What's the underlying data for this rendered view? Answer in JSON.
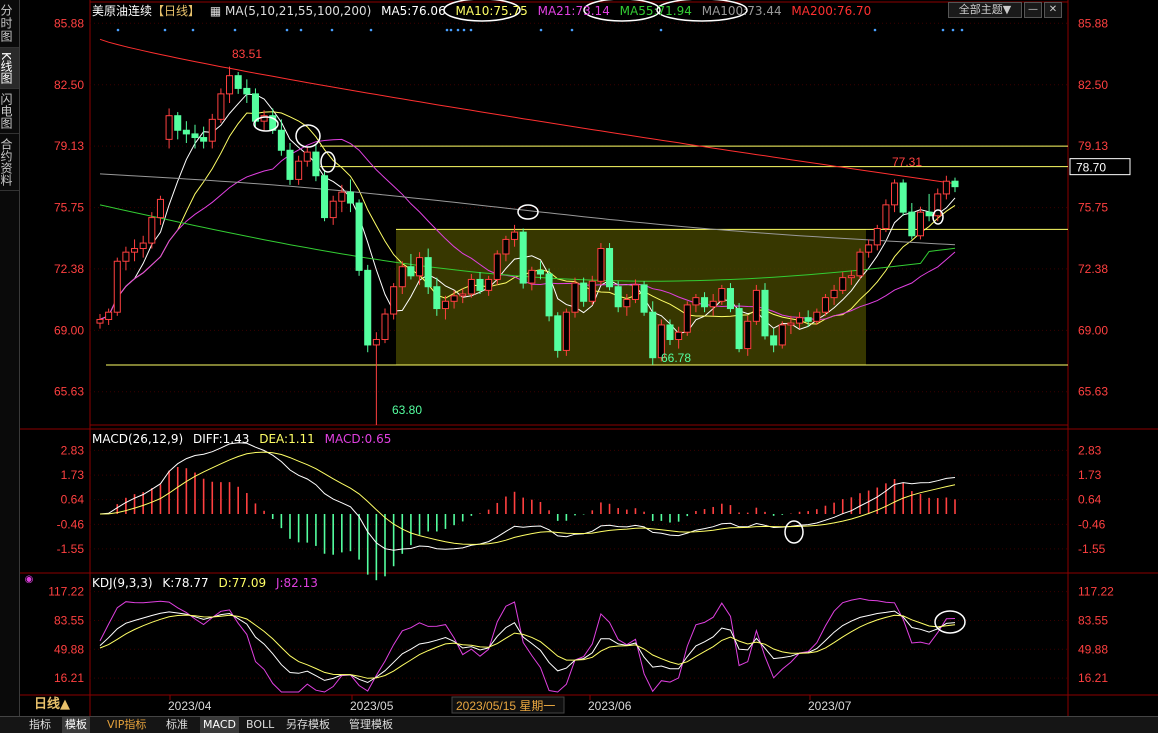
{
  "sidebar": {
    "tabs": [
      {
        "label": "分时图"
      },
      {
        "label": "K线图"
      },
      {
        "label": "闪电图"
      },
      {
        "label": "合约资料"
      }
    ]
  },
  "main_legend": {
    "symbol": "美原油连续",
    "period": "【日线】",
    "ma_set": "MA(5,10,21,55,100,200)",
    "ma5": "MA5:76.06",
    "ma10": "MA10:75.75",
    "ma21": "MA21:73.14",
    "ma55": "MA55:71.94",
    "ma100": "MA100:73.44",
    "ma200": "MA200:76.70"
  },
  "toolbar": {
    "theme_label": "全部主题▼",
    "min_label": "—",
    "close_label": "✕"
  },
  "macd_legend": {
    "name": "MACD(26,12,9)",
    "diff": "DIFF:1.43",
    "dea": "DEA:1.11",
    "macd": "MACD:0.65"
  },
  "kdj_legend": {
    "name": "KDJ(9,3,3)",
    "k": "K:78.77",
    "d": "D:77.09",
    "j": "J:82.13"
  },
  "price_axis": {
    "ticks": [
      "85.88",
      "82.50",
      "79.13",
      "75.75",
      "72.38",
      "69.00",
      "65.63"
    ],
    "last_price_label": "78.70"
  },
  "macd_axis": {
    "ticks": [
      "2.83",
      "1.73",
      "0.64",
      "-0.46",
      "-1.55"
    ]
  },
  "kdj_axis": {
    "ticks": [
      "117.22",
      "83.55",
      "49.88",
      "16.21"
    ]
  },
  "annotations": {
    "high": "83.51",
    "low": "63.80",
    "range_low": "66.78",
    "recent_high": "77.31"
  },
  "date_axis": {
    "labels": [
      "2023/04",
      "2023/05",
      "2023/06",
      "2023/07"
    ],
    "cursor_date": "2023/05/15 星期一"
  },
  "bottom_tabs": [
    {
      "label": "指标"
    },
    {
      "label": "模板"
    },
    {
      "label": "VIP指标"
    },
    {
      "label": "标准"
    },
    {
      "label": "MACD"
    },
    {
      "label": "BOLL"
    },
    {
      "label": "另存模板"
    },
    {
      "label": "管理模板"
    }
  ],
  "period_button": "日线▲",
  "colors": {
    "up": "#ff4040",
    "down": "#54ff9f",
    "ma5": "#ffffff",
    "ma10": "#ffff66",
    "ma21": "#e040e0",
    "ma55": "#33cc33",
    "ma100": "#999999",
    "ma200": "#ff3030",
    "grid": "#7a0000"
  },
  "chart_data": {
    "type": "candlestick",
    "title": "美原油连续",
    "price_ylim": [
      63.8,
      86.5
    ],
    "levels": [
      79.13,
      78.0,
      74.55,
      67.1
    ],
    "candles": [
      [
        69.4,
        69.9,
        69.1,
        69.6
      ],
      [
        69.6,
        70.2,
        69.3,
        70.0
      ],
      [
        70.0,
        73.0,
        69.8,
        72.8
      ],
      [
        72.8,
        73.6,
        72.3,
        73.3
      ],
      [
        73.3,
        74.0,
        72.8,
        73.5
      ],
      [
        73.5,
        74.2,
        73.0,
        73.8
      ],
      [
        73.8,
        75.5,
        73.5,
        75.2
      ],
      [
        75.2,
        76.4,
        74.8,
        76.2
      ],
      [
        79.5,
        81.2,
        79.0,
        80.8
      ],
      [
        80.8,
        81.0,
        79.5,
        80.0
      ],
      [
        80.0,
        80.5,
        79.3,
        79.8
      ],
      [
        79.8,
        80.3,
        79.0,
        79.6
      ],
      [
        79.6,
        80.2,
        79.0,
        79.4
      ],
      [
        79.4,
        80.9,
        79.0,
        80.6
      ],
      [
        80.6,
        82.3,
        80.4,
        82.0
      ],
      [
        82.0,
        83.5,
        81.5,
        83.0
      ],
      [
        83.0,
        83.2,
        82.0,
        82.3
      ],
      [
        82.3,
        82.8,
        81.5,
        82.0
      ],
      [
        82.0,
        82.3,
        80.2,
        80.5
      ],
      [
        80.5,
        81.1,
        80.0,
        80.8
      ],
      [
        80.8,
        81.2,
        79.8,
        80.0
      ],
      [
        80.0,
        80.6,
        78.6,
        78.9
      ],
      [
        78.9,
        79.3,
        77.0,
        77.3
      ],
      [
        77.3,
        78.6,
        77.0,
        78.3
      ],
      [
        78.3,
        79.1,
        78.0,
        78.8
      ],
      [
        78.8,
        79.2,
        77.2,
        77.5
      ],
      [
        77.5,
        77.8,
        75.0,
        75.2
      ],
      [
        75.2,
        76.4,
        74.8,
        76.1
      ],
      [
        76.1,
        77.0,
        75.5,
        76.6
      ],
      [
        76.6,
        77.3,
        75.5,
        76.0
      ],
      [
        76.0,
        76.2,
        72.0,
        72.3
      ],
      [
        72.3,
        72.6,
        67.8,
        68.2
      ],
      [
        68.2,
        68.9,
        63.8,
        68.5
      ],
      [
        68.5,
        70.2,
        68.3,
        69.9
      ],
      [
        69.9,
        71.6,
        69.6,
        71.4
      ],
      [
        71.4,
        72.8,
        71.0,
        72.5
      ],
      [
        72.5,
        73.2,
        71.8,
        72.0
      ],
      [
        72.0,
        73.3,
        71.5,
        73.0
      ],
      [
        73.0,
        73.5,
        71.0,
        71.4
      ],
      [
        71.4,
        71.9,
        69.8,
        70.2
      ],
      [
        70.2,
        70.9,
        69.6,
        70.6
      ],
      [
        70.6,
        71.2,
        70.2,
        70.9
      ],
      [
        70.9,
        71.3,
        70.5,
        71.0
      ],
      [
        71.0,
        72.1,
        70.8,
        71.8
      ],
      [
        71.8,
        72.2,
        71.0,
        71.2
      ],
      [
        71.2,
        72.0,
        70.9,
        71.8
      ],
      [
        71.8,
        73.4,
        71.5,
        73.2
      ],
      [
        73.2,
        74.2,
        72.8,
        74.0
      ],
      [
        74.0,
        74.8,
        73.6,
        74.4
      ],
      [
        74.4,
        74.6,
        71.3,
        71.6
      ],
      [
        71.6,
        72.5,
        71.2,
        72.3
      ],
      [
        72.3,
        72.8,
        71.8,
        72.1
      ],
      [
        72.1,
        72.4,
        69.5,
        69.8
      ],
      [
        69.8,
        70.0,
        67.5,
        67.9
      ],
      [
        67.9,
        70.2,
        67.6,
        70.0
      ],
      [
        70.0,
        71.9,
        69.7,
        71.6
      ],
      [
        71.6,
        71.9,
        70.3,
        70.6
      ],
      [
        70.6,
        72.0,
        70.4,
        71.7
      ],
      [
        71.7,
        73.8,
        71.5,
        73.5
      ],
      [
        73.5,
        73.8,
        71.2,
        71.4
      ],
      [
        71.4,
        71.7,
        70.0,
        70.3
      ],
      [
        70.3,
        71.0,
        69.8,
        70.7
      ],
      [
        70.7,
        71.8,
        70.5,
        71.5
      ],
      [
        71.5,
        71.7,
        69.8,
        70.0
      ],
      [
        70.0,
        70.6,
        67.1,
        67.5
      ],
      [
        67.5,
        69.6,
        67.3,
        69.3
      ],
      [
        69.3,
        69.6,
        68.2,
        68.5
      ],
      [
        68.5,
        69.2,
        68.0,
        68.9
      ],
      [
        68.9,
        70.6,
        68.7,
        70.4
      ],
      [
        70.4,
        71.0,
        70.0,
        70.8
      ],
      [
        70.8,
        71.1,
        70.0,
        70.3
      ],
      [
        70.3,
        71.0,
        69.8,
        70.6
      ],
      [
        70.6,
        71.5,
        70.4,
        71.3
      ],
      [
        71.3,
        71.6,
        70.0,
        70.2
      ],
      [
        70.2,
        70.5,
        67.8,
        68.0
      ],
      [
        68.0,
        69.8,
        67.6,
        69.5
      ],
      [
        69.5,
        71.5,
        69.3,
        71.2
      ],
      [
        71.2,
        71.6,
        68.5,
        68.7
      ],
      [
        68.7,
        69.1,
        67.8,
        68.2
      ],
      [
        68.2,
        69.5,
        68.0,
        69.3
      ],
      [
        69.3,
        69.8,
        68.8,
        69.4
      ],
      [
        69.4,
        70.0,
        69.1,
        69.7
      ],
      [
        69.7,
        70.1,
        69.2,
        69.5
      ],
      [
        69.5,
        70.2,
        69.3,
        70.0
      ],
      [
        70.0,
        71.0,
        69.8,
        70.8
      ],
      [
        70.8,
        71.5,
        70.4,
        71.2
      ],
      [
        71.2,
        72.2,
        71.0,
        71.9
      ],
      [
        71.9,
        72.3,
        71.5,
        72.0
      ],
      [
        72.0,
        73.5,
        71.8,
        73.3
      ],
      [
        73.3,
        74.0,
        73.0,
        73.7
      ],
      [
        73.7,
        74.8,
        73.4,
        74.6
      ],
      [
        74.6,
        76.2,
        74.4,
        75.9
      ],
      [
        75.9,
        77.3,
        75.5,
        77.1
      ],
      [
        77.1,
        77.3,
        75.3,
        75.5
      ],
      [
        75.5,
        76.0,
        74.0,
        74.2
      ],
      [
        74.2,
        75.8,
        74.0,
        75.5
      ],
      [
        75.5,
        76.5,
        75.0,
        75.3
      ],
      [
        75.3,
        76.8,
        75.0,
        76.5
      ],
      [
        76.5,
        77.5,
        76.2,
        77.2
      ],
      [
        77.2,
        77.4,
        76.6,
        76.9
      ]
    ],
    "macd_ylim": [
      -2.4,
      3.2
    ],
    "kdj_ylim": [
      0,
      125
    ]
  }
}
